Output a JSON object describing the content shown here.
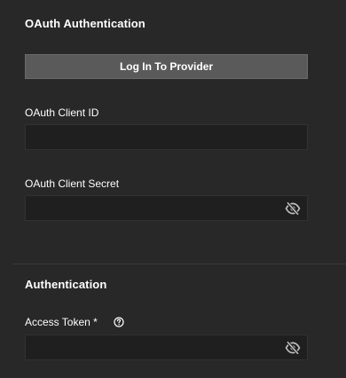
{
  "oauth": {
    "section_title": "OAuth Authentication",
    "login_button_label": "Log In To Provider",
    "client_id": {
      "label": "OAuth Client ID",
      "value": ""
    },
    "client_secret": {
      "label": "OAuth Client Secret",
      "value": "",
      "visibility_icon": "eye-off-icon"
    }
  },
  "authentication": {
    "section_title": "Authentication",
    "access_token": {
      "label": "Access Token *",
      "value": "",
      "help_icon": "help-circle-icon",
      "visibility_icon": "eye-off-icon"
    }
  },
  "colors": {
    "background": "#282828",
    "input_background": "#1f1f1f",
    "button_background": "#5a5a5a",
    "text": "#ffffff"
  }
}
